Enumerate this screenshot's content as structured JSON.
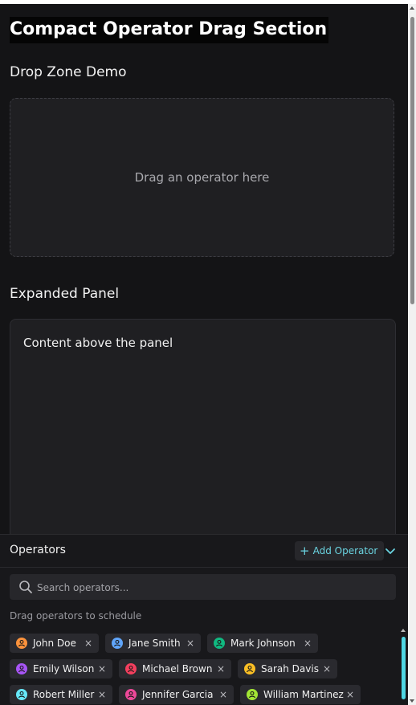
{
  "page": {
    "title": "Compact Operator Drag Section"
  },
  "drop_zone": {
    "heading": "Drop Zone Demo",
    "placeholder": "Drag an operator here"
  },
  "expanded_panel": {
    "heading": "Expanded Panel",
    "content": "Content above the panel"
  },
  "operators_panel": {
    "title": "Operators",
    "add_button": "Add Operator",
    "collapse_icon": "chevron-down-icon",
    "search_placeholder": "Search operators...",
    "hint": "Drag operators to schedule",
    "operators": [
      {
        "name": "John Doe",
        "color": "#fb923c"
      },
      {
        "name": "Jane Smith",
        "color": "#60a5fa"
      },
      {
        "name": "Mark Johnson",
        "color": "#10b981"
      },
      {
        "name": "Emily Wilson",
        "color": "#a855f7"
      },
      {
        "name": "Michael Brown",
        "color": "#f43f5e"
      },
      {
        "name": "Sarah Davis",
        "color": "#fbbf24"
      },
      {
        "name": "Robert Miller",
        "color": "#67e8f9"
      },
      {
        "name": "Jennifer Garcia",
        "color": "#ec4899"
      },
      {
        "name": "William Martinez",
        "color": "#a3e635"
      }
    ],
    "remove_glyph": "×"
  },
  "colors": {
    "background": "#141416",
    "accent": "#6ad3e0",
    "chip_background": "#2a2a2f"
  }
}
